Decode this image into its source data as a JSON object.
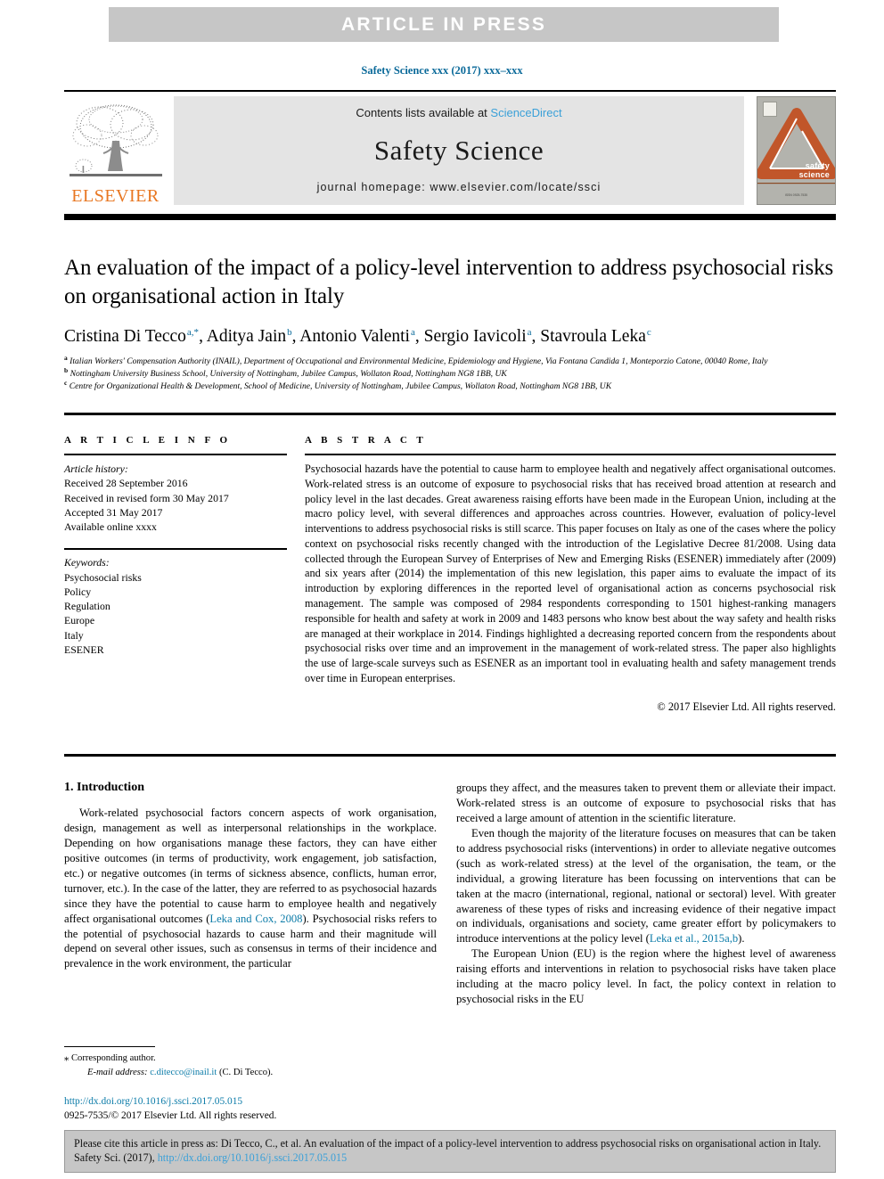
{
  "banner": {
    "article_in_press": "ARTICLE  IN  PRESS"
  },
  "journal_ref": "Safety Science xxx (2017) xxx–xxx",
  "masthead": {
    "contents_prefix": "Contents lists available at ",
    "sciencedirect": "ScienceDirect",
    "journal_name": "Safety Science",
    "homepage": "journal homepage: www.elsevier.com/locate/ssci",
    "publisher_name": "ELSEVIER",
    "cover_title_line1": "safety",
    "cover_title_line2": "science",
    "cover_footer": "ISSN 0925-7535"
  },
  "article": {
    "title": "An evaluation of the impact of a policy-level intervention to address psychosocial risks on organisational action in Italy",
    "authors": [
      {
        "name": "Cristina Di Tecco",
        "sup": "a,*"
      },
      {
        "name": "Aditya Jain",
        "sup": "b"
      },
      {
        "name": "Antonio Valenti",
        "sup": "a"
      },
      {
        "name": "Sergio Iavicoli",
        "sup": "a"
      },
      {
        "name": "Stavroula Leka",
        "sup": "c"
      }
    ],
    "affiliations": [
      {
        "mark": "a",
        "text": "Italian Workers' Compensation Authority (INAIL), Department of Occupational and Environmental Medicine, Epidemiology and Hygiene, Via Fontana Candida 1, Monteporzio Catone, 00040 Rome, Italy"
      },
      {
        "mark": "b",
        "text": "Nottingham University Business School, University of Nottingham, Jubilee Campus, Wollaton Road, Nottingham NG8 1BB, UK"
      },
      {
        "mark": "c",
        "text": "Centre for Organizational Health & Development, School of Medicine, University of Nottingham, Jubilee Campus, Wollaton Road, Nottingham NG8 1BB, UK"
      }
    ]
  },
  "article_info": {
    "heading": "A R T I C L E   I N F O",
    "history_label": "Article history:",
    "history": [
      "Received 28 September 2016",
      "Received in revised form 30 May 2017",
      "Accepted 31 May 2017",
      "Available online xxxx"
    ],
    "keywords_label": "Keywords:",
    "keywords": [
      "Psychosocial risks",
      "Policy",
      "Regulation",
      "Europe",
      "Italy",
      "ESENER"
    ]
  },
  "abstract": {
    "heading": "A B S T R A C T",
    "text": "Psychosocial hazards have the potential to cause harm to employee health and negatively affect organisational outcomes. Work-related stress is an outcome of exposure to psychosocial risks that has received broad attention at research and policy level in the last decades. Great awareness raising efforts have been made in the European Union, including at the macro policy level, with several differences and approaches across countries. However, evaluation of policy-level interventions to address psychosocial risks is still scarce. This paper focuses on Italy as one of the cases where the policy context on psychosocial risks recently changed with the introduction of the Legislative Decree 81/2008. Using data collected through the European Survey of Enterprises of New and Emerging Risks (ESENER) immediately after (2009) and six years after (2014) the implementation of this new legislation, this paper aims to evaluate the impact of its introduction by exploring differences in the reported level of organisational action as concerns psychosocial risk management. The sample was composed of 2984 respondents corresponding to 1501 highest-ranking managers responsible for health and safety at work in 2009 and 1483 persons who know best about the way safety and health risks are managed at their workplace in 2014. Findings highlighted a decreasing reported concern from the respondents about psychosocial risks over time and an improvement in the management of work-related stress. The paper also highlights the use of large-scale surveys such as ESENER as an important tool in evaluating health and safety management trends over time in European enterprises.",
    "copyright": "© 2017 Elsevier Ltd. All rights reserved."
  },
  "body": {
    "section_title": "1. Introduction",
    "left_paragraphs": [
      {
        "segments": [
          {
            "type": "text",
            "value": "Work-related psychosocial factors concern aspects of work organisation, design, management as well as interpersonal relationships in the workplace. Depending on how organisations manage these factors, they can have either positive outcomes (in terms of productivity, work engagement, job satisfaction, etc.) or negative outcomes (in terms of sickness absence, conflicts, human error, turnover, etc.). In the case of the latter, they are referred to as psychosocial hazards since they have the potential to cause harm to employee health and negatively affect organisational outcomes ("
          },
          {
            "type": "link",
            "value": "Leka and Cox, 2008"
          },
          {
            "type": "text",
            "value": "). Psychosocial risks refers to the potential of psychosocial hazards to cause harm and their magnitude will depend on several other issues, such as consensus in terms of their incidence and prevalence in the work environment, the particular"
          }
        ]
      }
    ],
    "right_paragraphs": [
      {
        "indent": false,
        "segments": [
          {
            "type": "text",
            "value": "groups they affect, and the measures taken to prevent them or alleviate their impact. Work-related stress is an outcome of exposure to psychosocial risks that has received a large amount of attention in the scientific literature."
          }
        ]
      },
      {
        "indent": true,
        "segments": [
          {
            "type": "text",
            "value": "Even though the majority of the literature focuses on measures that can be taken to address psychosocial risks (interventions) in order to alleviate negative outcomes (such as work-related stress) at the level of the organisation, the team, or the individual, a growing literature has been focussing on interventions that can be taken at the macro (international, regional, national or sectoral) level. With greater awareness of these types of risks and increasing evidence of their negative impact on individuals, organisations and society, came greater effort by policymakers to introduce interventions at the policy level ("
          },
          {
            "type": "link",
            "value": "Leka et al., 2015a,b"
          },
          {
            "type": "text",
            "value": ")."
          }
        ]
      },
      {
        "indent": true,
        "segments": [
          {
            "type": "text",
            "value": "The European Union (EU) is the region where the highest level of awareness raising efforts and interventions in relation to psychosocial risks have taken place including at the macro policy level. In fact, the policy context in relation to psychosocial risks in the EU"
          }
        ]
      }
    ]
  },
  "footnotes": {
    "corresponding": "Corresponding author.",
    "corresponding_mark": "⁎",
    "email_label": "E-mail address:",
    "email": "c.ditecco@inail.it",
    "email_owner": "(C. Di Tecco)."
  },
  "doi_block": {
    "doi_url": "http://dx.doi.org/10.1016/j.ssci.2017.05.015",
    "issn_line": "0925-7535/© 2017 Elsevier Ltd. All rights reserved."
  },
  "cite_banner": {
    "prefix": "Please cite this article in press as: Di Tecco, C., et al. An evaluation of the impact of a policy-level intervention to address psychosocial risks on organisational action in Italy. Safety Sci. (2017), ",
    "doi_url": "http://dx.doi.org/10.1016/j.ssci.2017.05.015"
  },
  "colors": {
    "banner_gray": "#c6c6c6",
    "masthead_gray": "#e4e4e4",
    "link_blue": "#0b7ba8",
    "sciencedirect_blue": "#3aa0d8",
    "elsevier_orange": "#e87722",
    "cover_orange": "#c1562a"
  }
}
